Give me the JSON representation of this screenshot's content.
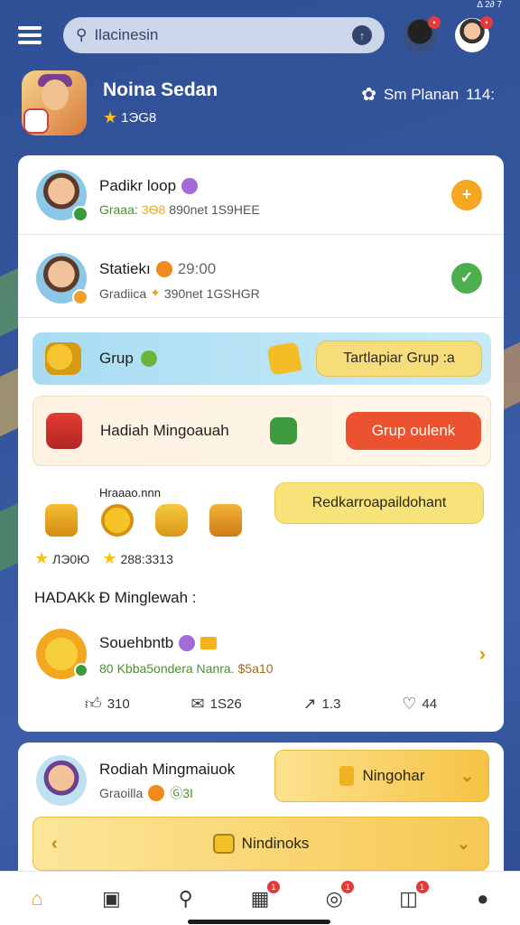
{
  "status": {
    "time": "Δ 2∂ 7"
  },
  "search": {
    "value": "Ilacinesin"
  },
  "profile": {
    "name": "Noina Sedan",
    "level": "1ЭG8",
    "right_label": "Sm Planan",
    "right_value": "114:"
  },
  "friends": [
    {
      "name": "Padikr loop",
      "detail_label": "Graaa:",
      "detail_value": "3Ѳ8",
      "detail_tail": "890net 1S9HEE",
      "action_icon": "plus-icon"
    },
    {
      "name": "Statiekı",
      "badge_value": "29:00",
      "detail_label": "Gradiica",
      "detail_value": "",
      "detail_tail": "390net 1GSHGR",
      "action_icon": "check-icon"
    }
  ],
  "group_banner": {
    "label": "Grup",
    "button": "Tartlapiar Grup :a"
  },
  "weekly_banner": {
    "label": "Hadiah Mingoauah",
    "button": "Grup oulenk"
  },
  "rewards": {
    "title": "Hraaao.nnn",
    "button": "Redkarroapaildohant",
    "stat1": "ЛЭ0Ю",
    "stat2": "288:3313"
  },
  "section": {
    "title": "HADAKk Ð Minglewah :"
  },
  "featured": {
    "name": "Souehbntb",
    "detail": "Kbba5ondera Nanra.",
    "detail_tail": "$5a10",
    "prefix": "80"
  },
  "social": {
    "likes": "310",
    "comments": "1S26",
    "shares": "1.3",
    "other": "44"
  },
  "bottom_card": {
    "name": "Rodiah Mingmaiuok",
    "detail": "Graoilla",
    "value": "Ⓖ3Ι",
    "button": "Ningohar",
    "bar_label": "Nindinoks"
  },
  "nav": {
    "badge2": "1",
    "badge3": "1",
    "badge4": "1"
  }
}
